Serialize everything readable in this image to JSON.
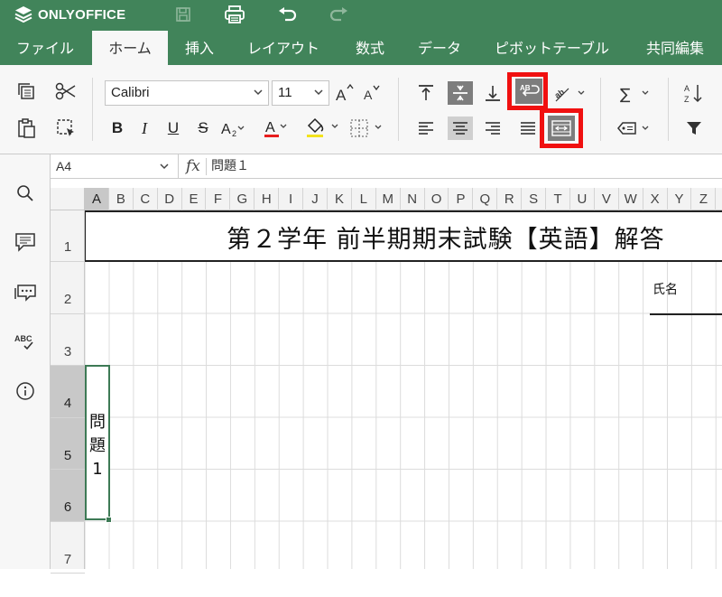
{
  "app": {
    "name": "ONLYOFFICE",
    "brand_color": "#41845a",
    "highlight_color": "#f01010"
  },
  "toolbar": {
    "icons": [
      "save-icon",
      "print-icon",
      "undo-icon",
      "redo-icon"
    ]
  },
  "tabs": [
    {
      "label": "ファイル",
      "active": false
    },
    {
      "label": "ホーム",
      "active": true
    },
    {
      "label": "挿入",
      "active": false
    },
    {
      "label": "レイアウト",
      "active": false
    },
    {
      "label": "数式",
      "active": false
    },
    {
      "label": "データ",
      "active": false
    },
    {
      "label": "ピボットテーブル",
      "active": false
    },
    {
      "label": "共同編集",
      "active": false
    }
  ],
  "ribbon": {
    "font_name": "Calibri",
    "font_size": "11",
    "highlighted_buttons": [
      "wrap-text-button",
      "merge-cells-button"
    ]
  },
  "formula_bar": {
    "cell_ref": "A4",
    "fx_label": "fx",
    "value": "問題１"
  },
  "sheet": {
    "columns": [
      "A",
      "B",
      "C",
      "D",
      "E",
      "F",
      "G",
      "H",
      "I",
      "J",
      "K",
      "L",
      "M",
      "N",
      "O",
      "P",
      "Q",
      "R",
      "S",
      "T",
      "U",
      "V",
      "W",
      "X",
      "Y",
      "Z"
    ],
    "selected_column": "A",
    "rows": [
      "1",
      "2",
      "3",
      "4",
      "5",
      "6",
      "7"
    ],
    "selected_rows": [
      "4",
      "5",
      "6"
    ],
    "title": "第２学年  前半期期末試験【英語】解答",
    "name_label": "氏名",
    "selected_cell_text": "問題１",
    "selected_cell_lines": [
      "問",
      "題",
      "1"
    ]
  }
}
